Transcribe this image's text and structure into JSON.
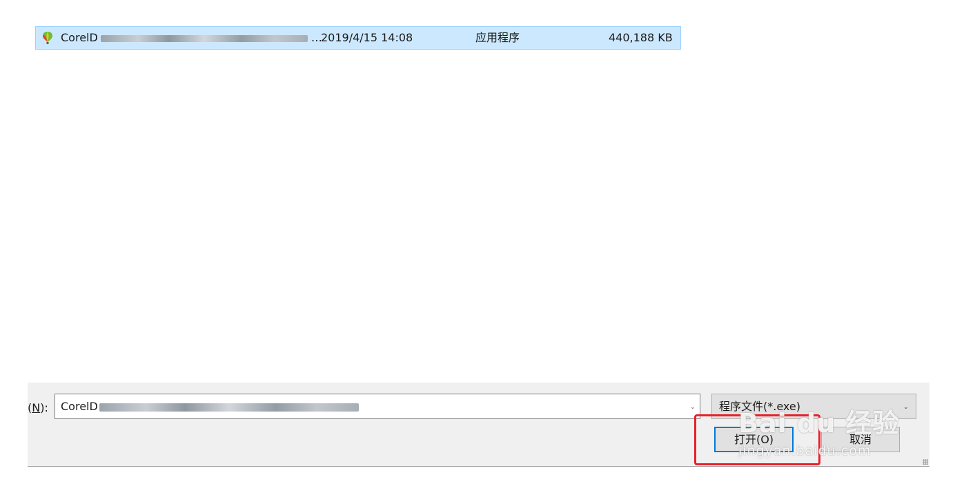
{
  "file_list": {
    "rows": [
      {
        "name": "CorelD",
        "date": "2019/4/15 14:08",
        "type": "应用程序",
        "size": "440,188 KB",
        "icon": "coreldraw-balloon-icon",
        "selected": true
      }
    ]
  },
  "bottom": {
    "filename_label_suffix": "(N):",
    "filename_label_mnemonic": "N",
    "filename_value": "CorelD",
    "filter_value": "程序文件(*.exe)",
    "open_label": "打开(O)",
    "cancel_label": "取消"
  },
  "watermark": {
    "main": "Bai du 经验",
    "sub": "jingyan.baidu.com"
  },
  "colors": {
    "selection_bg": "#cce8ff",
    "selection_border": "#99d1ff",
    "highlight_red": "#e8202a",
    "default_button_border": "#0078d7"
  }
}
